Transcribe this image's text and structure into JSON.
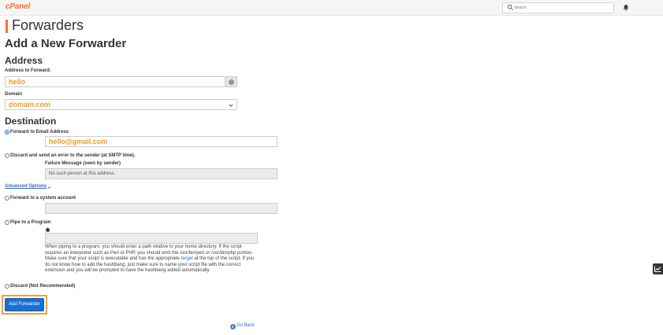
{
  "app": {
    "logo_text": "cPanel"
  },
  "search": {
    "placeholder": "Search"
  },
  "page": {
    "title": "Forwarders",
    "heading": "Add a New Forwarder"
  },
  "address": {
    "section_title": "Address",
    "forward_label": "Address to Forward:",
    "forward_value": "hello",
    "domain_label": "Domain",
    "domain_value": "domain.com"
  },
  "destination": {
    "section_title": "Destination",
    "email_option_label": "Forward to Email Address",
    "email_value": "hello@gmail.com",
    "discard_error_label": "Discard and send an error to the sender (at SMTP time).",
    "failure_message_label": "Failure Message (seen by sender)",
    "failure_message_value": "No such person at this address.",
    "advanced_options_label": "Advanced Options",
    "system_account_label": "Forward to a system account",
    "pipe_label": "Pipe to a Program",
    "pipe_help_before": "When piping to a program, you should enter a path relative to your home directory. If the script requires an interpreter such as Perl or PHP, you should omit the /usr/bin/perl or /usr/bin/php portion. Make sure that your script is executable and has the appropriate ",
    "pipe_help_link": "target",
    "pipe_help_after": " at the top of the script. If you do not know how to add the hashbang, just make sure to name your script file with the correct extension and you will be prompted to have the hashbang added automatically.",
    "discard_label": "Discard (Not Recommended)"
  },
  "actions": {
    "add_button": "Add Forwarder",
    "go_back": "Go Back"
  },
  "colors": {
    "brand": "#ff6c2c",
    "primary": "#1a6fd1",
    "highlight": "#f0a138",
    "value_text": "#f29a1c"
  },
  "icons": [
    "search-icon",
    "bell-icon",
    "at-sign-icon",
    "chevron-down-icon",
    "home-icon",
    "arrow-left-circle-icon",
    "chart-icon"
  ]
}
